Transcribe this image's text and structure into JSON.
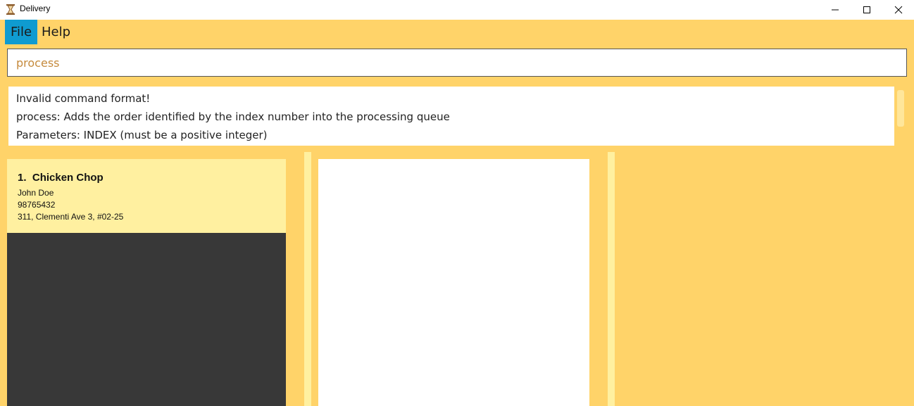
{
  "window": {
    "title": "Delivery",
    "app_icon": "hourglass-app-icon",
    "controls": [
      "minimize",
      "maximize",
      "close"
    ]
  },
  "menu": {
    "file_label": "File",
    "help_label": "Help"
  },
  "command": {
    "value": "process"
  },
  "result": {
    "lines": [
      "Invalid command format!",
      "process: Adds the order identified by the index number into the processing queue",
      "Parameters: INDEX (must be a positive integer)"
    ]
  },
  "orders": [
    {
      "index": "1.",
      "name": "Chicken Chop",
      "customer": "John Doe",
      "phone": "98765432",
      "address": "311, Clementi Ave 3, #02-25"
    }
  ],
  "colors": {
    "background": "#FFD369",
    "card": "#FFF0A0",
    "menu_active": "#0F9BD0",
    "list_panel": "#383838",
    "command_text": "#C58A3C"
  }
}
